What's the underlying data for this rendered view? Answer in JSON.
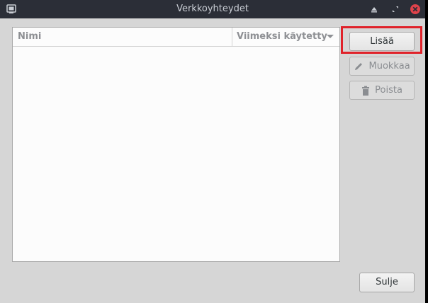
{
  "window": {
    "title": "Verkkoyhteydet"
  },
  "titlebar": {
    "app_icon": "network-connections-icon",
    "minimize_icon": "minimize-icon",
    "maximize_icon": "maximize-icon",
    "close_icon": "close-icon",
    "close_color": "#e0434b"
  },
  "list": {
    "columns": [
      {
        "label": "Nimi"
      },
      {
        "label": "Viimeksi käytetty",
        "sort_icon": "sort-down-icon"
      }
    ],
    "rows": []
  },
  "buttons": {
    "add_label": "Lisää",
    "edit_label": "Muokkaa",
    "edit_icon": "pencil-icon",
    "delete_label": "Poista",
    "delete_icon": "trash-icon",
    "close_label": "Sulje"
  },
  "colors": {
    "highlight": "#e0222a",
    "titlebar_bg": "#2b2e37",
    "window_bg": "#d6d6d6"
  }
}
